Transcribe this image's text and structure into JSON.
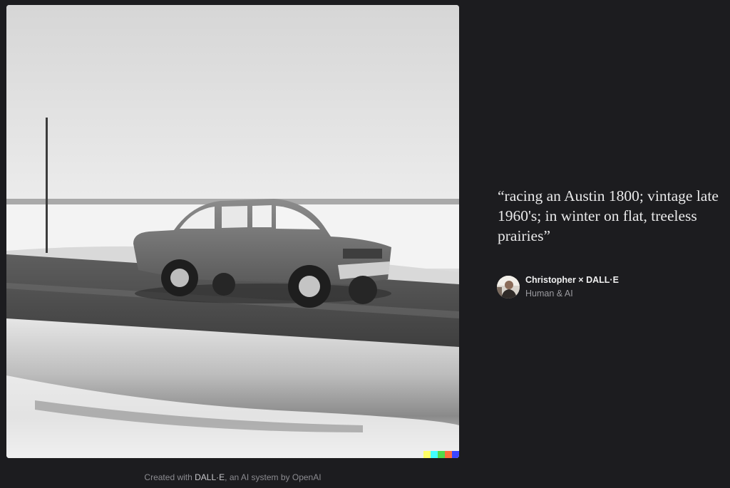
{
  "image": {
    "alt_subject": "vintage car racing on snowy prairie road",
    "signature_colors": [
      "#ffff66",
      "#42ffff",
      "#51da4c",
      "#ff6e3c",
      "#3c46ff"
    ]
  },
  "prompt": {
    "text": "“racing an Austin 1800; vintage late 1960's; in winter on flat, treeless prairies”"
  },
  "credit": {
    "name": "Christopher × DALL·E",
    "subtitle": "Human & AI",
    "avatar_icon": "user-avatar"
  },
  "footer": {
    "prefix": "Created with ",
    "product": "DALL·E",
    "suffix": ", an AI system by OpenAI"
  }
}
